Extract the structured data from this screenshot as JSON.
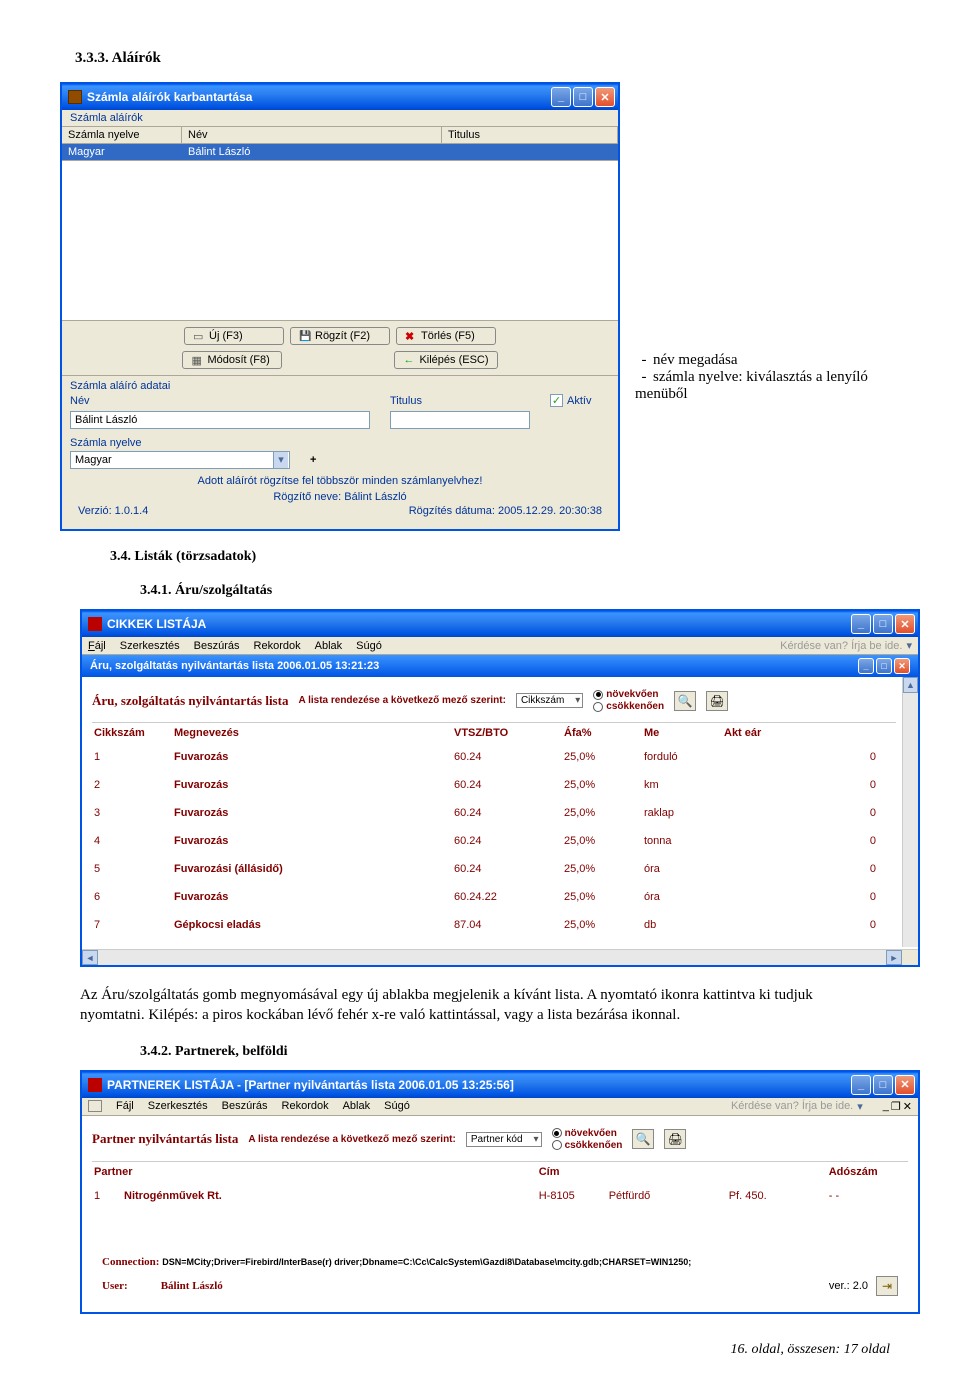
{
  "doc": {
    "section_number": "3.3.3. Aláírók",
    "section_34": "3.4. Listák (törzsadatok)",
    "section_341": "3.4.1. Áru/szolgáltatás",
    "section_342": "3.4.2. Partnerek, belföldi",
    "para1": "Az Áru/szolgáltatás gomb megnyomásával egy új ablakba megjelenik a kívánt lista. A nyomtató ikonra kattintva ki tudjuk nyomtatni. Kilépés: a piros kockában lévő fehér x-re való kattintással, vagy a lista bezárása ikonnal.",
    "footer": "16. oldal, összesen: 17 oldal"
  },
  "side_notes": {
    "i1": "név megadása",
    "i2": "számla nyelve: kiválasztás a lenyíló menüből"
  },
  "win1": {
    "title": "Számla aláírók karbantartása",
    "subheader": "Számla aláírók",
    "col1": "Számla nyelve",
    "col2": "Név",
    "col3": "Titulus",
    "row_lang": "Magyar",
    "row_name": "Bálint László",
    "btn_new": "Új (F3)",
    "btn_save": "Rögzít (F2)",
    "btn_del": "Törlés (F5)",
    "btn_edit": "Módosít (F8)",
    "btn_exit": "Kilépés (ESC)",
    "panel_title": "Számla aláíró adatai",
    "lbl_nev": "Név",
    "lbl_titulus": "Titulus",
    "lbl_aktiv": "Aktív",
    "lbl_nyelv": "Számla nyelve",
    "val_nev": "Bálint László",
    "val_nyelv": "Magyar",
    "plus": "+",
    "hint": "Adott aláírót rögzítse fel többször minden számlanyelvhez!",
    "rec_name_lbl": "Rögzítő neve:",
    "rec_name": "Bálint László",
    "rec_date_lbl": "Rögzítés dátuma:",
    "rec_date": "2005.12.29. 20:30:38",
    "version": "Verzió: 1.0.1.4"
  },
  "menubar": {
    "file": "Fájl",
    "edit": "Szerkesztés",
    "insert": "Beszúrás",
    "records": "Rekordok",
    "window": "Ablak",
    "help": "Súgó",
    "search": "Kérdése van? Írja be ide."
  },
  "win2": {
    "outer_title": "CIKKEK LISTÁJA",
    "inner_title": "Áru, szolgáltatás nyilvántartás lista    2006.01.05 13:21:23",
    "list_title": "Áru, szolgáltatás nyilvántartás lista",
    "sort_label": "A lista rendezése a következő mező szerint:",
    "sort_value": "Cikkszám",
    "rad_asc": "növekvően",
    "rad_desc": "csökkenően",
    "cols": {
      "c1": "Cikkszám",
      "c2": "Megnevezés",
      "c3": "VTSZ/BTO",
      "c4": "Áfa%",
      "c5": "Me",
      "c6": "Akt eár"
    },
    "rows": [
      {
        "n": "1",
        "name": "Fuvarozás",
        "vtsz": "60.24",
        "afa": "25,0%",
        "me": "forduló",
        "ar": "0"
      },
      {
        "n": "2",
        "name": "Fuvarozás",
        "vtsz": "60.24",
        "afa": "25,0%",
        "me": "km",
        "ar": "0"
      },
      {
        "n": "3",
        "name": "Fuvarozás",
        "vtsz": "60.24",
        "afa": "25,0%",
        "me": "raklap",
        "ar": "0"
      },
      {
        "n": "4",
        "name": "Fuvarozás",
        "vtsz": "60.24",
        "afa": "25,0%",
        "me": "tonna",
        "ar": "0"
      },
      {
        "n": "5",
        "name": "Fuvarozási (állásidő)",
        "vtsz": "60.24",
        "afa": "25,0%",
        "me": "óra",
        "ar": "0"
      },
      {
        "n": "6",
        "name": "Fuvarozás",
        "vtsz": "60.24.22",
        "afa": "25,0%",
        "me": "óra",
        "ar": "0"
      },
      {
        "n": "7",
        "name": "Gépkocsi eladás",
        "vtsz": "87.04",
        "afa": "25,0%",
        "me": "db",
        "ar": "0"
      }
    ]
  },
  "win3": {
    "outer_title": "PARTNEREK LISTÁJA - [Partner nyilvántartás lista    2006.01.05 13:25:56]",
    "list_title": "Partner nyilvántartás lista",
    "sort_label": "A lista rendezése a következő mező szerint:",
    "sort_value": "Partner kód",
    "rad_asc": "növekvően",
    "rad_desc": "csökkenően",
    "cols": {
      "c1": "Partner",
      "c2": "Cím",
      "c3": "Adószám"
    },
    "row": {
      "n": "1",
      "name": "Nitrogénművek Rt.",
      "zip": "H-8105",
      "city": "Pétfürdő",
      "pf": "Pf. 450.",
      "ado": "- -"
    },
    "conn_lbl": "Connection:",
    "conn_val": "DSN=MCity;Driver=Firebird/InterBase(r) driver;Dbname=C:\\Cc\\CalcSystem\\Gazdi8\\Database\\mcity.gdb;CHARSET=WIN1250;",
    "user_lbl": "User:",
    "user_val": "Bálint László",
    "ver": "ver.: 2.0"
  }
}
